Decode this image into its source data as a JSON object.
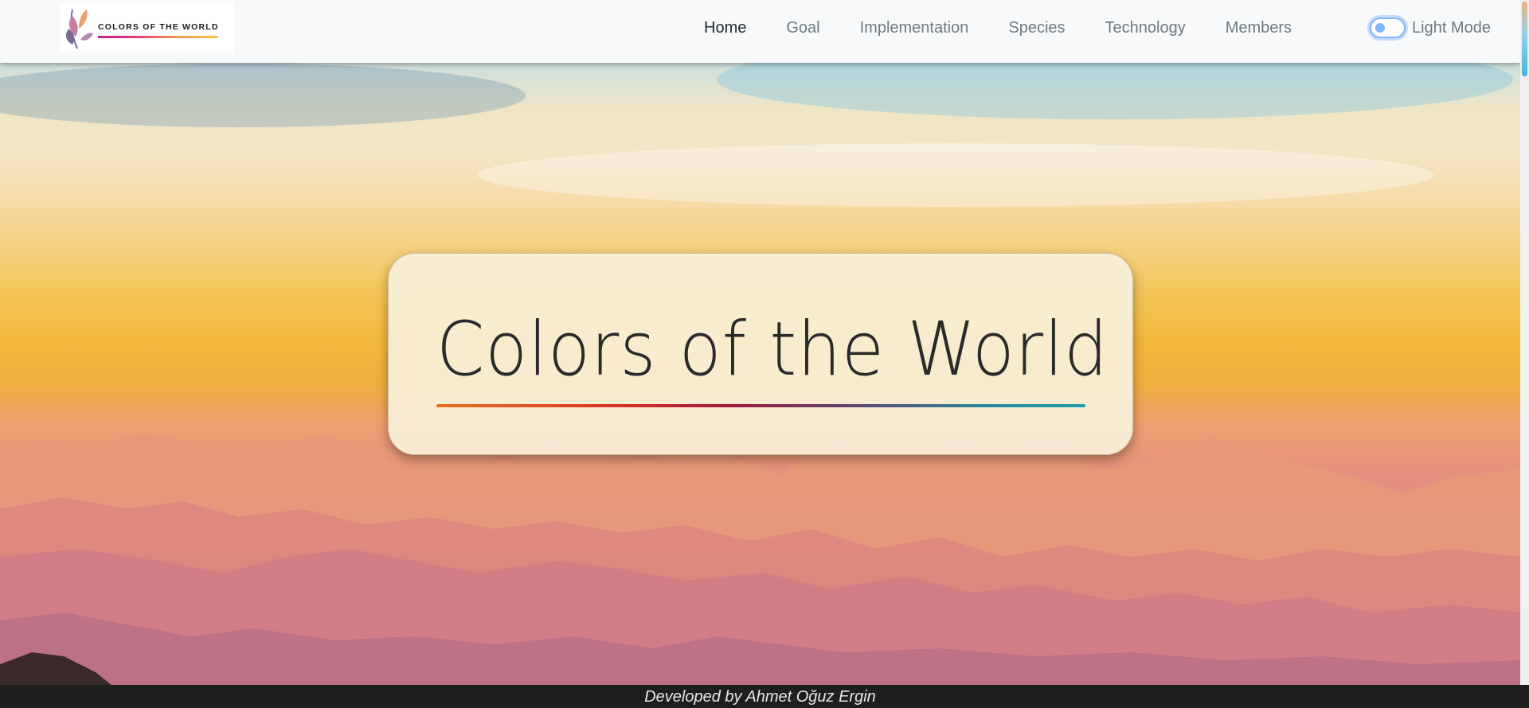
{
  "brand": {
    "logo_text": "COLORS OF THE WORLD"
  },
  "nav": {
    "items": [
      {
        "label": "Home",
        "active": true
      },
      {
        "label": "Goal",
        "active": false
      },
      {
        "label": "Implementation",
        "active": false
      },
      {
        "label": "Species",
        "active": false
      },
      {
        "label": "Technology",
        "active": false
      },
      {
        "label": "Members",
        "active": false
      }
    ],
    "mode_label": "Light Mode"
  },
  "hero": {
    "title": "Colors of the World"
  },
  "footer": {
    "credit": "Developed by Ahmet Oğuz Ergin"
  },
  "colors": {
    "navbar_bg": "#f8f9fa",
    "nav_active": "#1e2a30",
    "nav_inactive": "#6c7a82",
    "toggle_accent": "#86b7fe",
    "card_bg": "#faf2de",
    "footer_bg": "#1e1e1e"
  },
  "icons": [
    "leaf-logo-icon",
    "toggle-switch-icon"
  ]
}
